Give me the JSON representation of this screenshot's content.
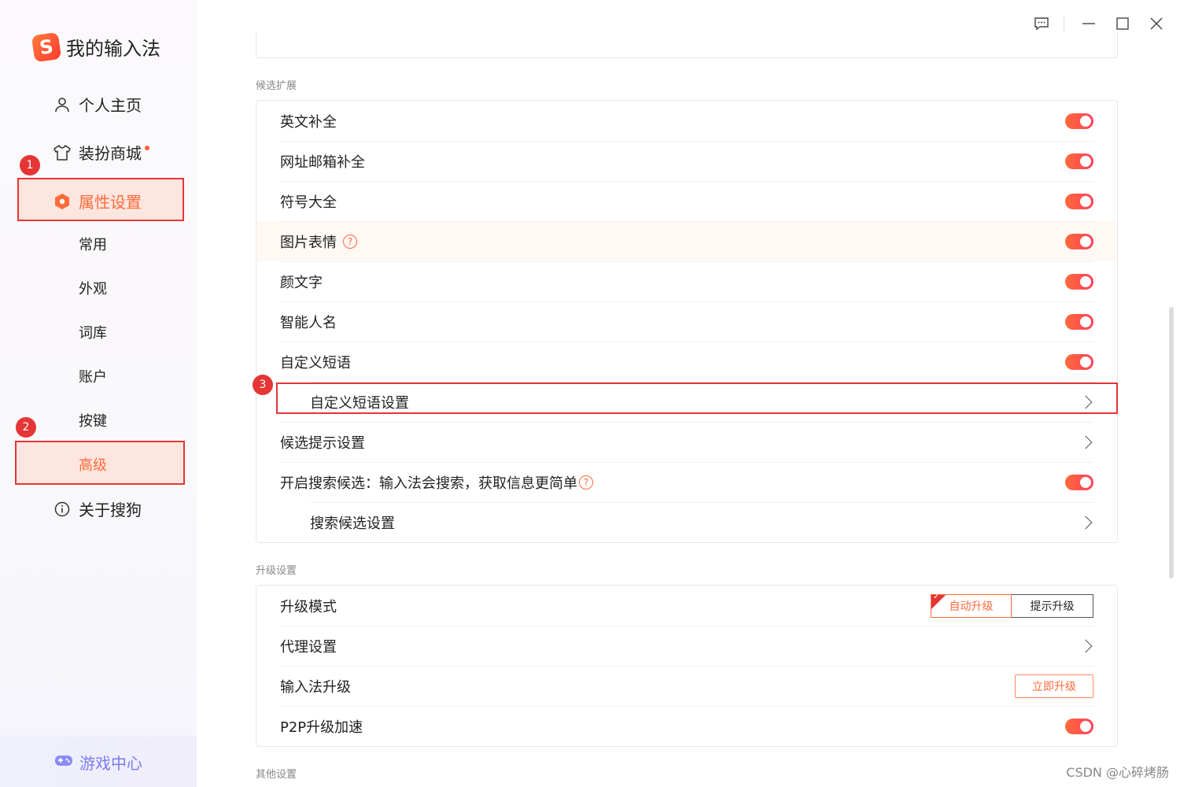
{
  "app": {
    "title": "我的输入法",
    "logo_letter": "S"
  },
  "sidebar": {
    "items": [
      {
        "label": "个人主页",
        "icon": "user-icon"
      },
      {
        "label": "装扮商城",
        "icon": "shirt-icon",
        "has_dot": true
      },
      {
        "label": "属性设置",
        "icon": "settings-hex-icon",
        "active": true
      },
      {
        "label": "关于搜狗",
        "icon": "info-icon"
      }
    ],
    "subitems": [
      "常用",
      "外观",
      "词库",
      "账户",
      "按键",
      "高级"
    ],
    "active_subitem": "高级",
    "game_center": "游戏中心",
    "accent": "#ff6a3a"
  },
  "annotations": {
    "badge1": "1",
    "badge2": "2",
    "badge3": "3"
  },
  "sections": {
    "candidate_ext": {
      "label": "候选扩展",
      "rows": [
        {
          "label": "英文补全",
          "control": "toggle"
        },
        {
          "label": "网址邮箱补全",
          "control": "toggle"
        },
        {
          "label": "符号大全",
          "control": "toggle"
        },
        {
          "label": "图片表情",
          "control": "toggle",
          "help": "?"
        },
        {
          "label": "颜文字",
          "control": "toggle"
        },
        {
          "label": "智能人名",
          "control": "toggle"
        },
        {
          "label": "自定义短语",
          "control": "toggle"
        },
        {
          "label": "自定义短语设置",
          "control": "chevron"
        },
        {
          "label": "候选提示设置",
          "control": "chevron"
        },
        {
          "label": "开启搜索候选：输入法会搜索，获取信息更简单",
          "control": "toggle",
          "help": "?"
        },
        {
          "label": "搜索候选设置",
          "control": "chevron"
        }
      ]
    },
    "upgrade": {
      "label": "升级设置",
      "rows": [
        {
          "label": "升级模式",
          "options": [
            "自动升级",
            "提示升级"
          ],
          "selected": "自动升级"
        },
        {
          "label": "代理设置"
        },
        {
          "label": "输入法升级",
          "button": "立即升级"
        },
        {
          "label": "P2P升级加速"
        }
      ]
    },
    "other": {
      "label": "其他设置"
    }
  },
  "watermark": "CSDN @心碎烤肠"
}
